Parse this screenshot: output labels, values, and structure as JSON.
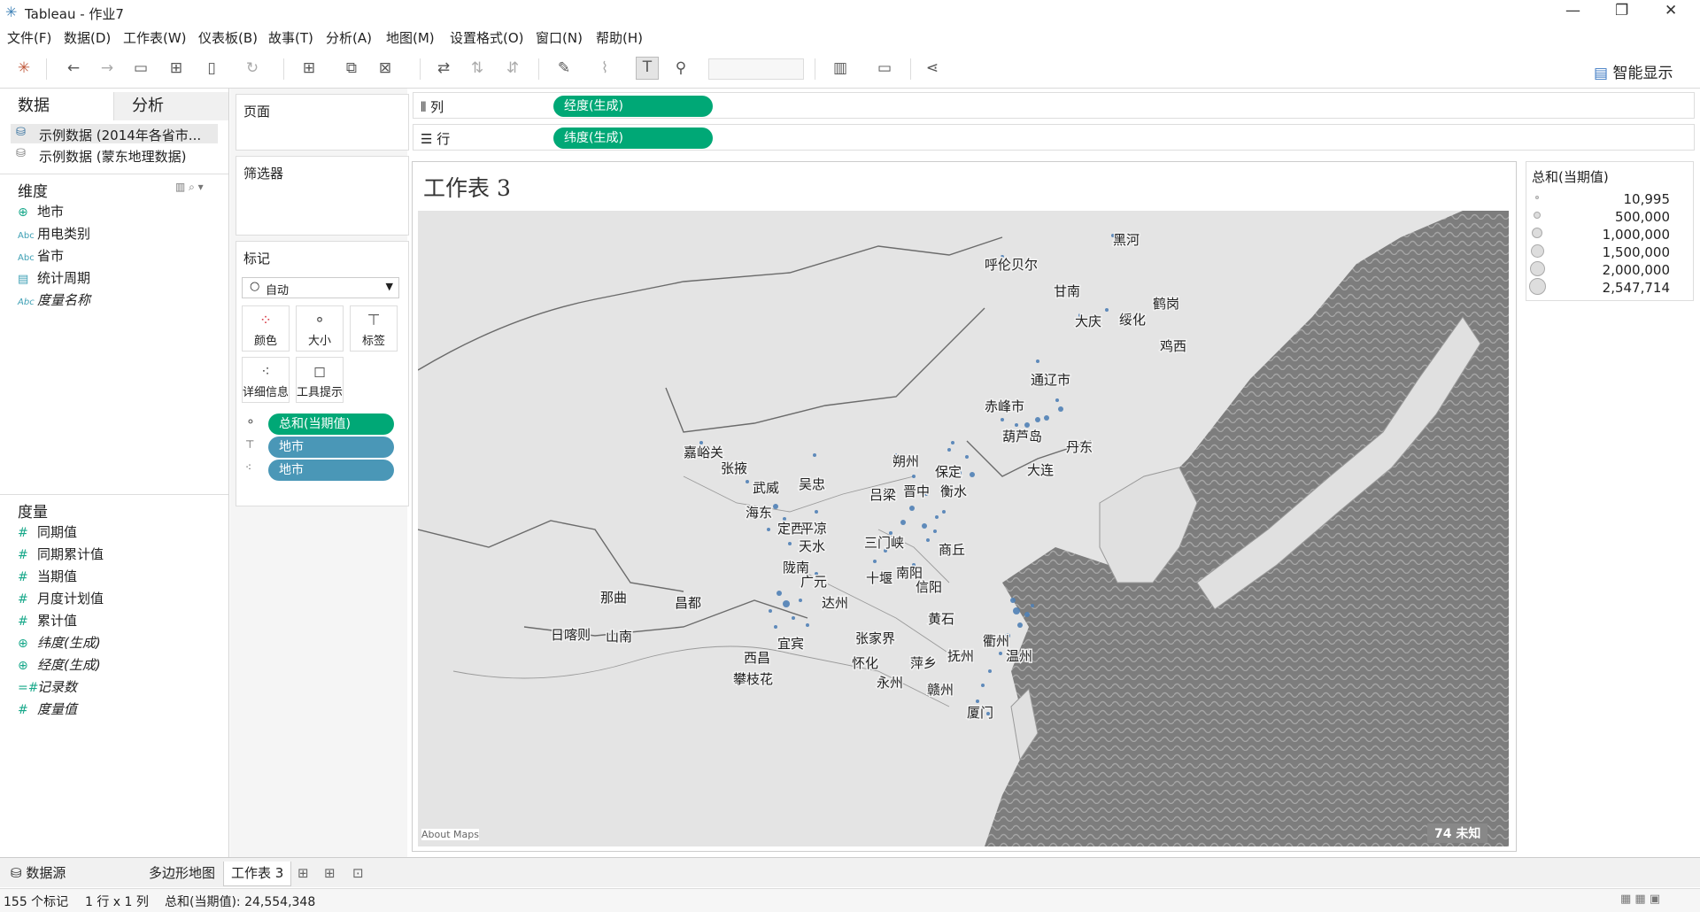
{
  "window": {
    "title": "Tableau - 作业7",
    "controls": [
      "—",
      "❐",
      "✕"
    ]
  },
  "menu": [
    "文件(F)",
    "数据(D)",
    "工作表(W)",
    "仪表板(B)",
    "故事(T)",
    "分析(A)",
    "地图(M)",
    "设置格式(O)",
    "窗口(N)",
    "帮助(H)"
  ],
  "toolbar": {
    "show_me": "智能显示"
  },
  "data_pane": {
    "tab_data": "数据",
    "tab_analysis": "分析",
    "sources": [
      "示例数据 (2014年各省市...",
      "示例数据 (蒙东地理数据)"
    ],
    "dimensions_header": "维度",
    "dimensions": [
      {
        "icon": "⊕",
        "label": "地市"
      },
      {
        "icon": "Abc",
        "label": "用电类别"
      },
      {
        "icon": "Abc",
        "label": "省市"
      },
      {
        "icon": "▤",
        "label": "统计周期"
      },
      {
        "icon": "Abc",
        "label": "度量名称"
      }
    ],
    "measures_header": "度量",
    "measures": [
      {
        "icon": "#",
        "label": "同期值"
      },
      {
        "icon": "#",
        "label": "同期累计值"
      },
      {
        "icon": "#",
        "label": "当期值"
      },
      {
        "icon": "#",
        "label": "月度计划值"
      },
      {
        "icon": "#",
        "label": "累计值"
      },
      {
        "icon": "⊕",
        "label": "纬度(生成)"
      },
      {
        "icon": "⊕",
        "label": "经度(生成)"
      },
      {
        "icon": "=#",
        "label": "记录数"
      },
      {
        "icon": "#",
        "label": "度量值"
      }
    ]
  },
  "cards": {
    "pages": "页面",
    "filters": "筛选器",
    "marks": "标记",
    "mark_type": "自动",
    "mark_buttons": [
      "颜色",
      "大小",
      "标签",
      "详细信息",
      "工具提示"
    ],
    "mark_pills": [
      "总和(当期值)",
      "地市",
      "地市"
    ]
  },
  "shelves": {
    "columns_label": "列",
    "columns_pill": "经度(生成)",
    "rows_label": "行",
    "rows_pill": "纬度(生成)"
  },
  "view": {
    "title": "工作表 3",
    "about_maps": "About Maps",
    "unknown": "74 未知"
  },
  "map_labels": [
    "黑河",
    "呼伦贝尔",
    "甘南",
    "鹤岗",
    "大庆",
    "绥化",
    "鸡西",
    "通辽市",
    "赤峰市",
    "葫芦岛",
    "丹东",
    "大连",
    "嘉峪关",
    "张掖",
    "武威",
    "吴忠",
    "海东",
    "定西",
    "平凉",
    "天水",
    "陇南",
    "广元",
    "达州",
    "朔州",
    "保定",
    "吕梁",
    "晋中",
    "衡水",
    "三门峡",
    "商丘",
    "十堰",
    "南阳",
    "信阳",
    "那曲",
    "昌都",
    "日喀则",
    "山南",
    "西昌",
    "攀枝花",
    "宜宾",
    "张家界",
    "怀化",
    "永州",
    "萍乡",
    "抚州",
    "赣州",
    "黄石",
    "衢州",
    "温州",
    "厦门"
  ],
  "legend": {
    "title": "总和(当期值)",
    "entries": [
      "10,995",
      "500,000",
      "1,000,000",
      "1,500,000",
      "2,000,000",
      "2,547,714"
    ]
  },
  "sheet_tabs": {
    "datasource": "数据源",
    "tabs": [
      "多边形地图",
      "工作表 3"
    ],
    "active": "工作表 3"
  },
  "status": {
    "marks": "155 个标记",
    "dims": "1 行 x 1 列",
    "sum": "总和(当期值): 24,554,348"
  }
}
